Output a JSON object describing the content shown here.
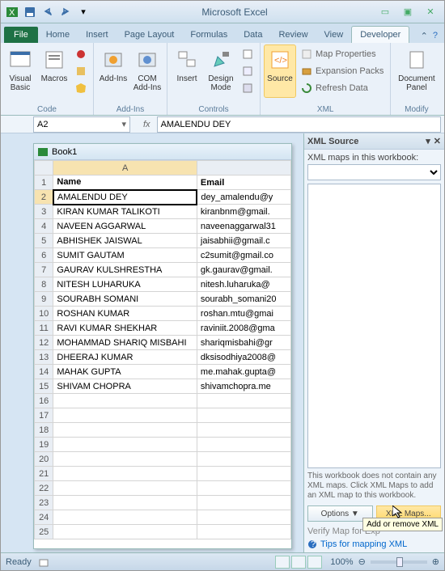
{
  "title": "Microsoft Excel",
  "tabs": [
    "Home",
    "Insert",
    "Page Layout",
    "Formulas",
    "Data",
    "Review",
    "View",
    "Developer"
  ],
  "active_tab": "Developer",
  "ribbon": {
    "groups": [
      "Code",
      "Add-Ins",
      "Controls",
      "XML",
      "Modify"
    ],
    "code": {
      "visual_basic": "Visual Basic",
      "macros": "Macros"
    },
    "addins": {
      "addins": "Add-Ins",
      "com": "COM Add-Ins"
    },
    "controls": {
      "insert": "Insert",
      "design": "Design Mode"
    },
    "xml": {
      "source": "Source",
      "map_properties": "Map Properties",
      "expansion_packs": "Expansion Packs",
      "refresh_data": "Refresh Data"
    },
    "modify": {
      "document_panel": "Document Panel"
    }
  },
  "name_box": "A2",
  "formula_value": "AMALENDU DEY",
  "book_title": "Book1",
  "columns": [
    "Name",
    "Email"
  ],
  "rows": [
    {
      "n": 1,
      "a": "Name",
      "b": "Email"
    },
    {
      "n": 2,
      "a": "AMALENDU DEY",
      "b": "dey_amalendu@y"
    },
    {
      "n": 3,
      "a": "KIRAN KUMAR TALIKOTI",
      "b": "kiranbnm@gmail."
    },
    {
      "n": 4,
      "a": "NAVEEN AGGARWAL",
      "b": "naveenaggarwal31"
    },
    {
      "n": 5,
      "a": "ABHISHEK JAISWAL",
      "b": "jaisabhii@gmail.c"
    },
    {
      "n": 6,
      "a": "SUMIT GAUTAM",
      "b": "c2sumit@gmail.co"
    },
    {
      "n": 7,
      "a": "GAURAV KULSHRESTHA",
      "b": "gk.gaurav@gmail."
    },
    {
      "n": 8,
      "a": "NITESH LUHARUKA",
      "b": "nitesh.luharuka@"
    },
    {
      "n": 9,
      "a": "SOURABH SOMANI",
      "b": "sourabh_somani20"
    },
    {
      "n": 10,
      "a": "ROSHAN KUMAR",
      "b": "roshan.mtu@gmai"
    },
    {
      "n": 11,
      "a": "RAVI KUMAR SHEKHAR",
      "b": "raviniit.2008@gma"
    },
    {
      "n": 12,
      "a": "MOHAMMAD SHARIQ MISBAHI",
      "b": "shariqmisbahi@gr"
    },
    {
      "n": 13,
      "a": "DHEERAJ KUMAR",
      "b": "dksisodhiya2008@"
    },
    {
      "n": 14,
      "a": "MAHAK GUPTA",
      "b": "me.mahak.gupta@"
    },
    {
      "n": 15,
      "a": "SHIVAM CHOPRA",
      "b": "shivamchopra.me"
    }
  ],
  "empty_rows": [
    16,
    17,
    18,
    19,
    20,
    21,
    22,
    23,
    24,
    25
  ],
  "xml_pane": {
    "title": "XML Source",
    "maps_label": "XML maps in this workbook:",
    "hint": "This workbook does not contain any XML maps. Click XML Maps to add an XML map to this workbook.",
    "options_btn": "Options ▼",
    "maps_btn": "XML Maps...",
    "verify": "Verify Map for Exp",
    "tooltip": "Add or remove XML",
    "tips_link": "Tips for mapping XML"
  },
  "status": {
    "ready": "Ready",
    "zoom": "100%"
  }
}
